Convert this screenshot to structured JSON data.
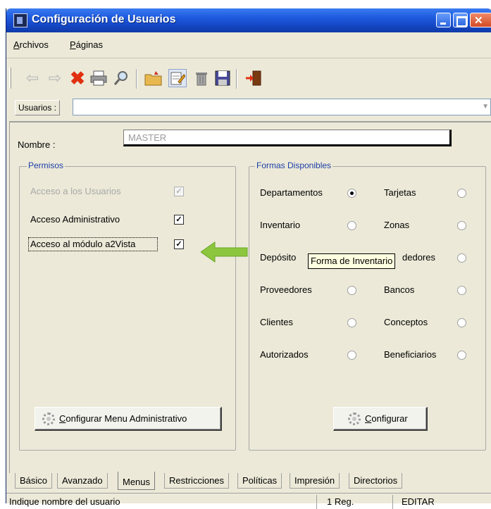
{
  "window": {
    "title": "Configuración de Usuarios",
    "title_color": "#1f5de0"
  },
  "menu": {
    "archivos": {
      "prefix": "A",
      "rest": "rchivos"
    },
    "paginas": {
      "prefix": "P",
      "rest": "áginas"
    }
  },
  "toolbar": {
    "icons": [
      "back-arrow-icon",
      "forward-arrow-icon",
      "delete-x-icon",
      "print-icon",
      "search-icon",
      "open-folder-icon",
      "edit-icon",
      "trash-icon",
      "save-icon",
      "exit-icon"
    ]
  },
  "usuarios": {
    "label": "Usuarios :",
    "value": ""
  },
  "nombre": {
    "label": "Nombre :",
    "value": "MASTER"
  },
  "permisos": {
    "title": "Permisos",
    "items": [
      {
        "label": "Acceso  a los Usuarios",
        "checked": true,
        "enabled": false
      },
      {
        "label": "Acceso  Administrativo",
        "checked": true,
        "enabled": true
      },
      {
        "label": "Acceso al módulo a2Vista",
        "checked": true,
        "enabled": true
      }
    ],
    "check_mark": "✓",
    "button": {
      "prefix": "C",
      "rest": "onfigurar Menu Administrativo"
    }
  },
  "formas": {
    "title": "Formas Disponibles",
    "left": [
      "Departamentos",
      "Inventario",
      "Depósito",
      "Proveedores",
      "Clientes",
      "Autorizados"
    ],
    "right": [
      "Tarjetas",
      "Zonas",
      "",
      "Bancos",
      "Conceptos",
      "Beneficiarios"
    ],
    "right_partial": "dedores",
    "selected": "Departamentos",
    "tooltip": "Forma de Inventario",
    "button": {
      "prefix": "C",
      "rest": "onfigurar"
    }
  },
  "tabs": [
    "Básico",
    "Avanzado",
    "Menus",
    "Restricciones",
    "Políticas",
    "Impresión",
    "Directorios"
  ],
  "active_tab": "Menus",
  "status": {
    "hint": "Indique nombre del usuario",
    "records": "1 Reg.",
    "mode": "EDITAR"
  },
  "accent": {
    "arrow_green": "#8cc63f",
    "delete_red": "#e03010",
    "group_title": "#1d3fa8"
  }
}
